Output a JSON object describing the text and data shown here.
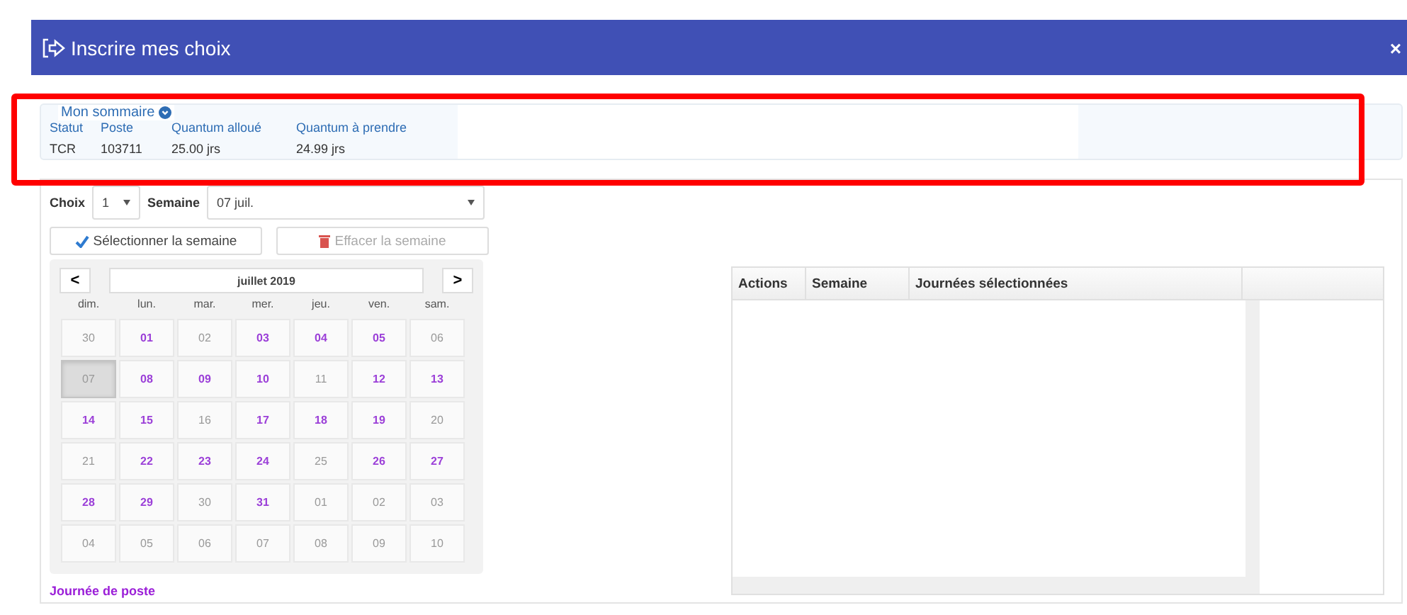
{
  "window": {
    "title": "Inscrire mes choix",
    "close": "×"
  },
  "summary": {
    "title": "Mon sommaire",
    "columns": [
      "Statut",
      "Poste",
      "Quantum alloué",
      "Quantum à prendre"
    ],
    "values": [
      "TCR",
      "103711",
      "25.00 jrs",
      "24.99 jrs"
    ]
  },
  "form": {
    "choice_label": "Choix",
    "choice_value": "1",
    "week_label": "Semaine",
    "week_value": "07 juil."
  },
  "buttons": [
    {
      "label": "Sélectionner la semaine",
      "kind": "select",
      "disabled": false
    },
    {
      "label": "Effacer la semaine",
      "kind": "clear",
      "disabled": true
    }
  ],
  "calendar": {
    "prev": "<",
    "next": ">",
    "month": "juillet 2019",
    "weekdays": [
      "dim.",
      "lun.",
      "mar.",
      "mer.",
      "jeu.",
      "ven.",
      "sam."
    ],
    "days": [
      {
        "label": "30",
        "active": false,
        "selected": false
      },
      {
        "label": "01",
        "active": true,
        "selected": false
      },
      {
        "label": "02",
        "active": false,
        "selected": false
      },
      {
        "label": "03",
        "active": true,
        "selected": false
      },
      {
        "label": "04",
        "active": true,
        "selected": false
      },
      {
        "label": "05",
        "active": true,
        "selected": false
      },
      {
        "label": "06",
        "active": false,
        "selected": false
      },
      {
        "label": "07",
        "active": false,
        "selected": true
      },
      {
        "label": "08",
        "active": true,
        "selected": false
      },
      {
        "label": "09",
        "active": true,
        "selected": false
      },
      {
        "label": "10",
        "active": true,
        "selected": false
      },
      {
        "label": "11",
        "active": false,
        "selected": false
      },
      {
        "label": "12",
        "active": true,
        "selected": false
      },
      {
        "label": "13",
        "active": true,
        "selected": false
      },
      {
        "label": "14",
        "active": true,
        "selected": false
      },
      {
        "label": "15",
        "active": true,
        "selected": false
      },
      {
        "label": "16",
        "active": false,
        "selected": false
      },
      {
        "label": "17",
        "active": true,
        "selected": false
      },
      {
        "label": "18",
        "active": true,
        "selected": false
      },
      {
        "label": "19",
        "active": true,
        "selected": false
      },
      {
        "label": "20",
        "active": false,
        "selected": false
      },
      {
        "label": "21",
        "active": false,
        "selected": false
      },
      {
        "label": "22",
        "active": true,
        "selected": false
      },
      {
        "label": "23",
        "active": true,
        "selected": false
      },
      {
        "label": "24",
        "active": true,
        "selected": false
      },
      {
        "label": "25",
        "active": false,
        "selected": false
      },
      {
        "label": "26",
        "active": true,
        "selected": false
      },
      {
        "label": "27",
        "active": true,
        "selected": false
      },
      {
        "label": "28",
        "active": true,
        "selected": false
      },
      {
        "label": "29",
        "active": true,
        "selected": false
      },
      {
        "label": "30",
        "active": false,
        "selected": false
      },
      {
        "label": "31",
        "active": true,
        "selected": false
      },
      {
        "label": "01",
        "active": false,
        "selected": false
      },
      {
        "label": "02",
        "active": false,
        "selected": false
      },
      {
        "label": "03",
        "active": false,
        "selected": false
      },
      {
        "label": "04",
        "active": false,
        "selected": false
      },
      {
        "label": "05",
        "active": false,
        "selected": false
      },
      {
        "label": "06",
        "active": false,
        "selected": false
      },
      {
        "label": "07",
        "active": false,
        "selected": false
      },
      {
        "label": "08",
        "active": false,
        "selected": false
      },
      {
        "label": "09",
        "active": false,
        "selected": false
      },
      {
        "label": "10",
        "active": false,
        "selected": false
      }
    ]
  },
  "legend": "Journée de poste",
  "table": {
    "columns": [
      "Actions",
      "Semaine",
      "Journées sélectionnées"
    ]
  }
}
